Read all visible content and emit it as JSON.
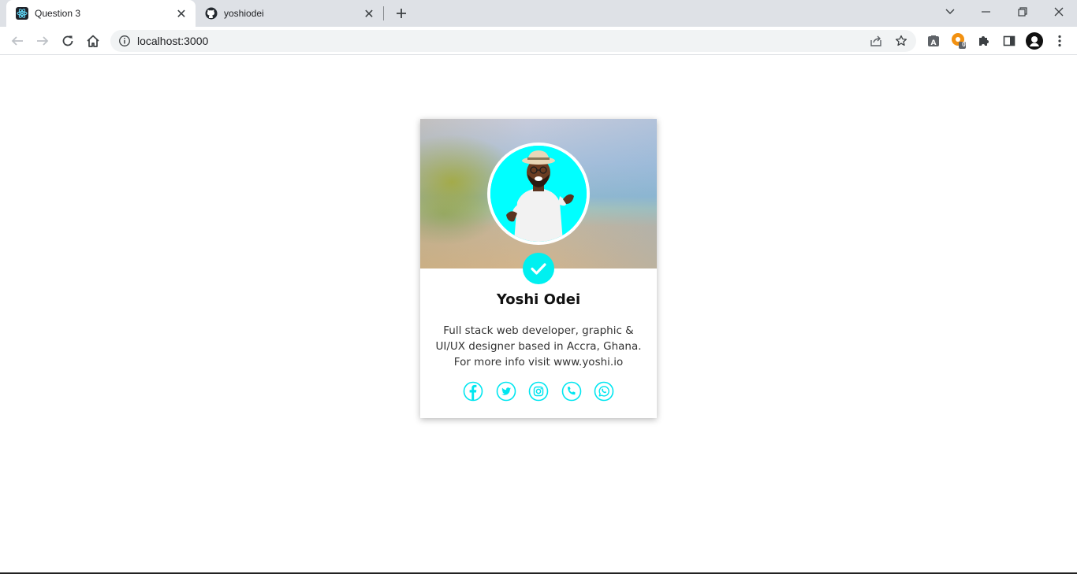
{
  "browser": {
    "tabs": [
      {
        "title": "Question 3",
        "favicon": "react-icon",
        "active": true
      },
      {
        "title": "yoshiodei",
        "favicon": "github-icon",
        "active": false
      }
    ],
    "url": "localhost:3000",
    "extension_badge": "0"
  },
  "profile": {
    "name": "Yoshi Odei",
    "bio": "Full stack web developer, graphic & UI/UX designer based in Accra, Ghana. For more info visit www.yoshi.io",
    "verified": true,
    "socials": [
      {
        "name": "facebook",
        "icon": "facebook-icon"
      },
      {
        "name": "twitter",
        "icon": "twitter-icon"
      },
      {
        "name": "instagram",
        "icon": "instagram-icon"
      },
      {
        "name": "phone",
        "icon": "phone-icon"
      },
      {
        "name": "whatsapp",
        "icon": "whatsapp-icon"
      }
    ]
  },
  "colors": {
    "accent": "#00ffff",
    "card_bg": "#ffffff",
    "page_bg": "#ffffff"
  }
}
